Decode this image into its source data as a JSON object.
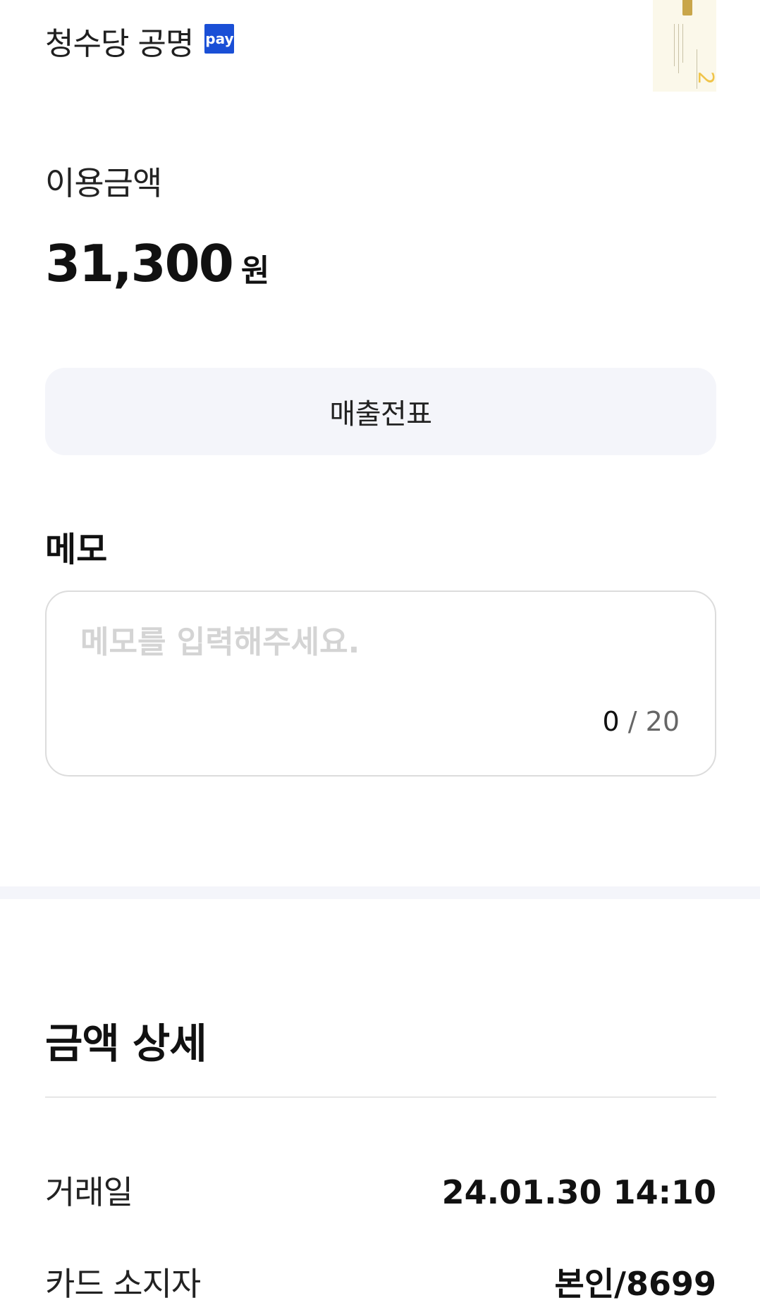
{
  "merchant": {
    "name": "청수당 공명",
    "pay_badge": "pay"
  },
  "card_thumbnail": {
    "number_mark": "2",
    "chip_color": "#c9a64a",
    "background_color": "#fbf8ea",
    "accent_color": "#f0c449"
  },
  "amount": {
    "label": "이용금액",
    "value": "31,300",
    "unit": "원"
  },
  "receipt": {
    "button_label": "매출전표"
  },
  "memo": {
    "title": "메모",
    "placeholder": "메모를 입력해주세요.",
    "value": "",
    "count": "0",
    "separator": "/",
    "max": "20"
  },
  "details": {
    "title": "금액 상세",
    "rows": [
      {
        "label": "거래일",
        "value": "24.01.30 14:10"
      },
      {
        "label": "카드 소지자",
        "value": "본인/8699"
      }
    ]
  },
  "colors": {
    "pay_badge": "#1a4fd6",
    "button_bg": "#f4f5fa",
    "section_band": "#f4f5fa"
  }
}
